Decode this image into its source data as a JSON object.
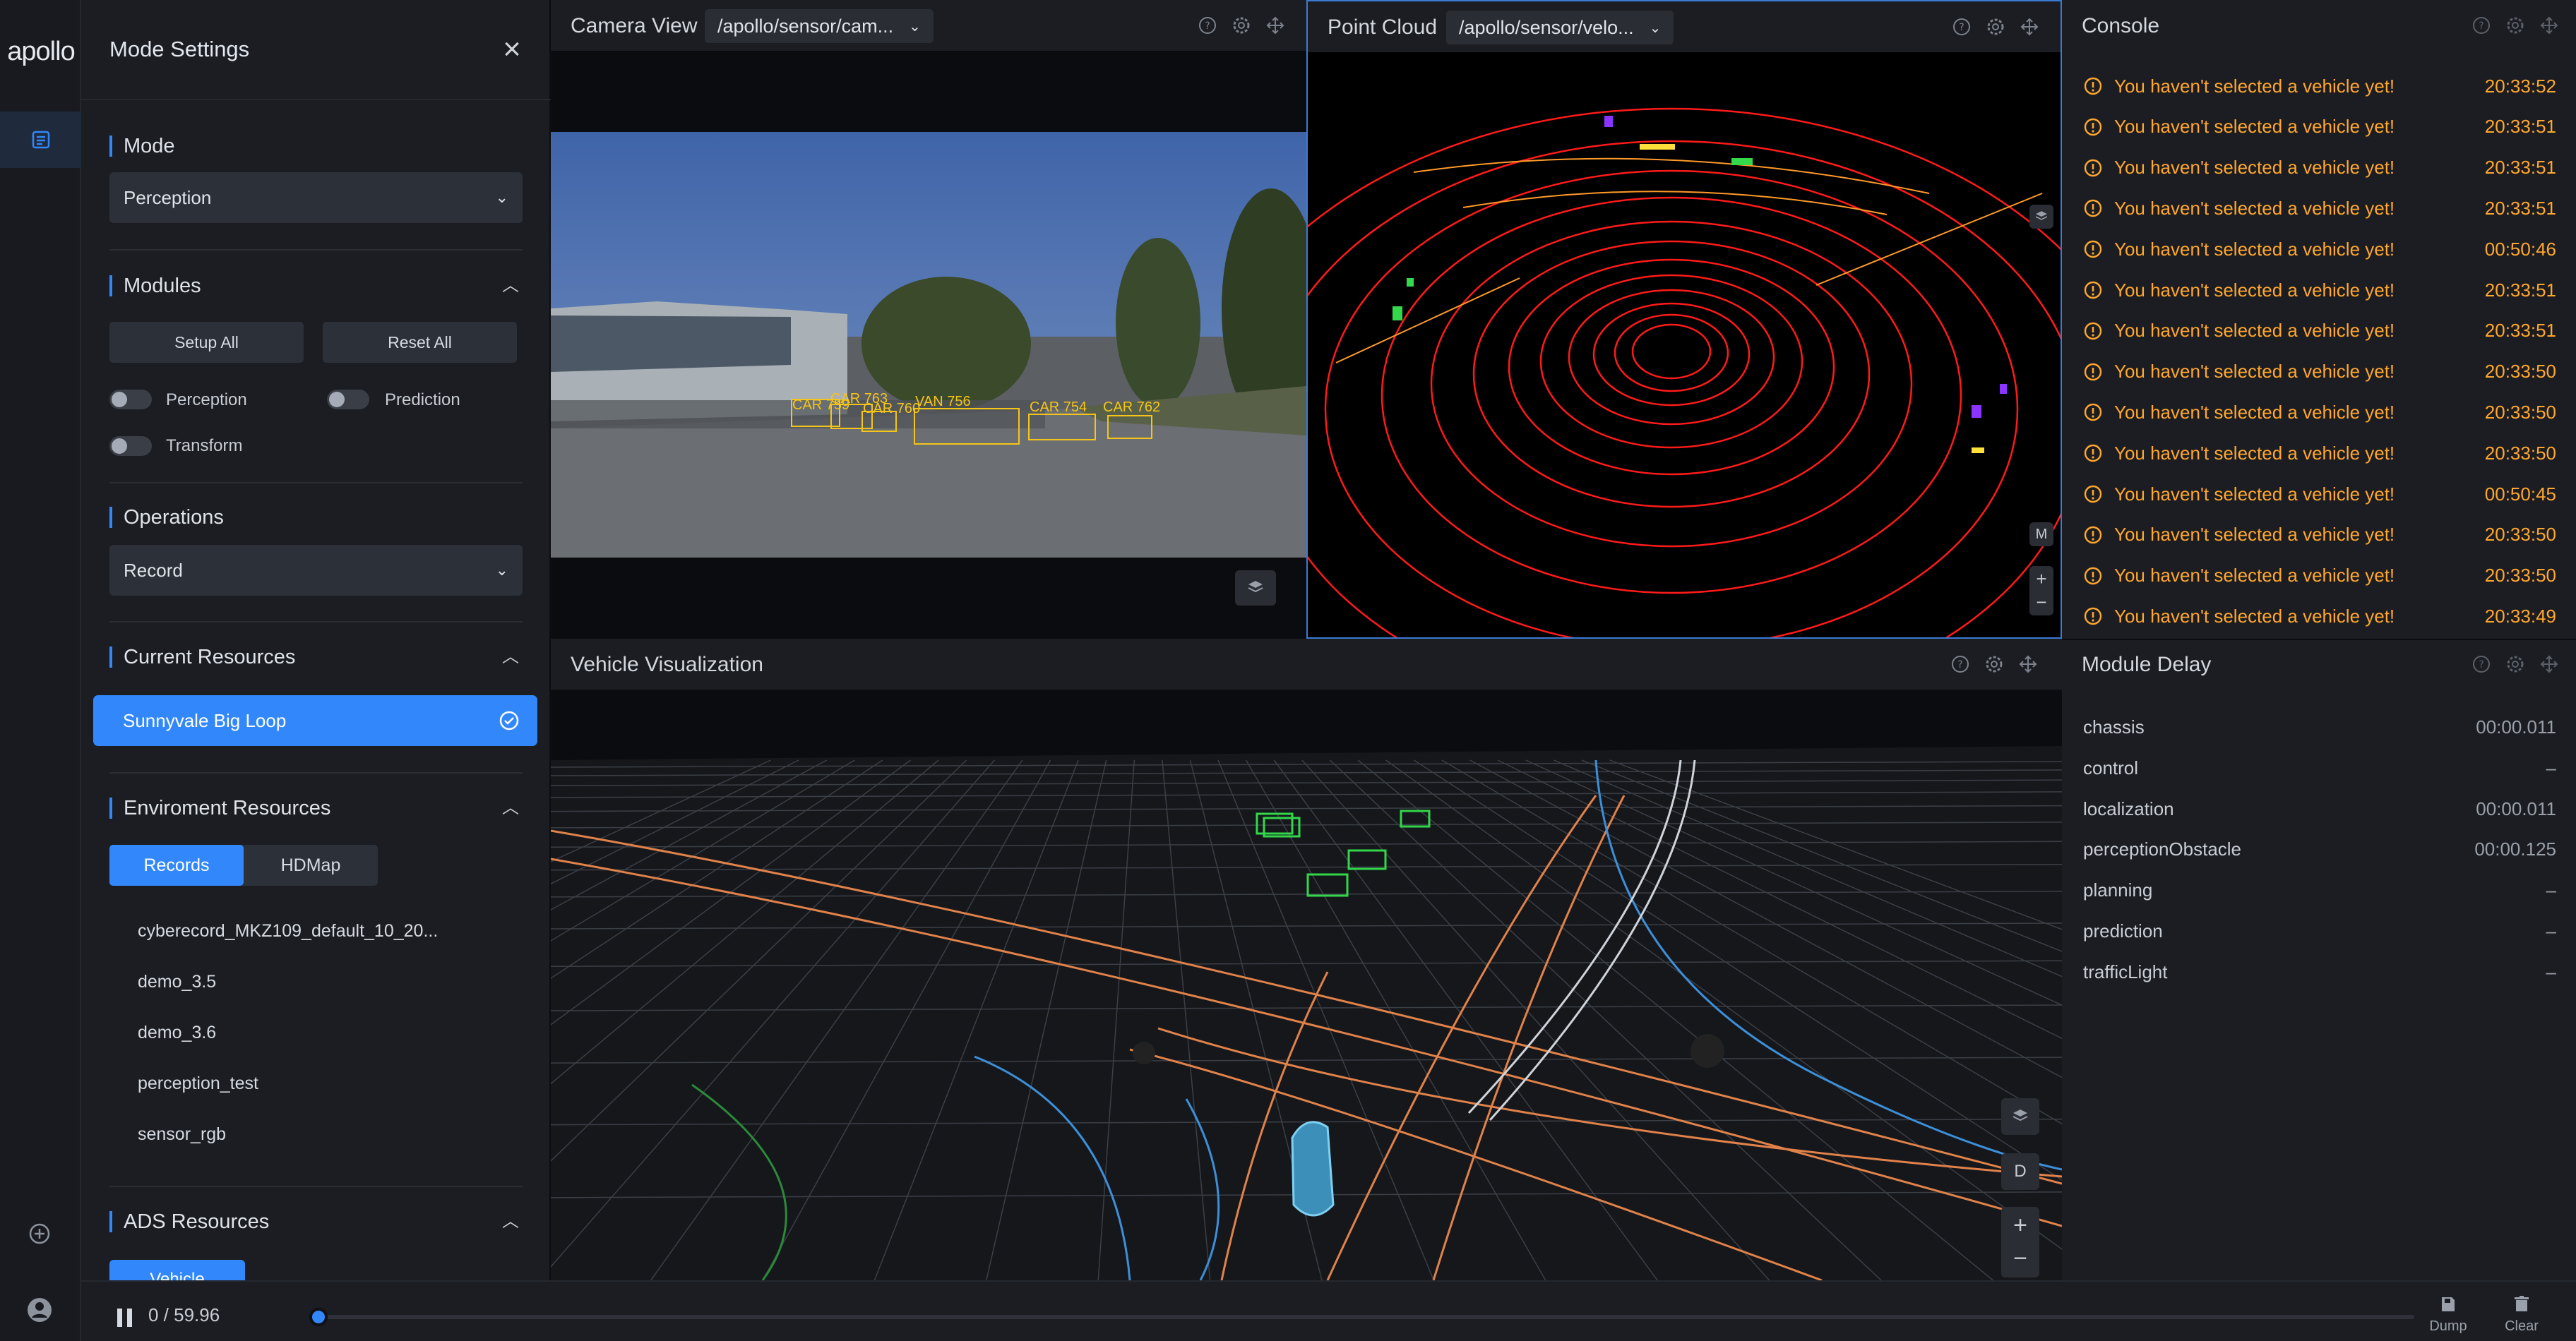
{
  "app": {
    "logo": "apollo"
  },
  "mode_settings": {
    "title": "Mode Settings",
    "mode": {
      "label": "Mode",
      "value": "Perception"
    },
    "modules": {
      "label": "Modules",
      "setup_all": "Setup All",
      "reset_all": "Reset All",
      "items": [
        "Perception",
        "Prediction",
        "Transform"
      ]
    },
    "operations": {
      "label": "Operations",
      "value": "Record"
    },
    "current_resources": {
      "label": "Current Resources",
      "selected": "Sunnyvale Big Loop"
    },
    "environment_resources": {
      "label": "Enviroment Resources",
      "tabs": [
        "Records",
        "HDMap"
      ],
      "active_tab": "Records",
      "records": [
        "cyberecord_MKZ109_default_10_20...",
        "demo_3.5",
        "demo_3.6",
        "perception_test",
        "sensor_rgb"
      ]
    },
    "ads_resources": {
      "label": "ADS Resources",
      "tab": "Vehicle"
    }
  },
  "camera_view": {
    "title": "Camera View",
    "topic": "/apollo/sensor/cam...",
    "detections": [
      "CAR 759",
      "CAR 763",
      "CAR 760",
      "VAN 756",
      "CAR 754",
      "CAR 762"
    ]
  },
  "point_cloud": {
    "title": "Point Cloud",
    "topic": "/apollo/sensor/velo...",
    "controls": [
      "M",
      "+",
      "−"
    ]
  },
  "vehicle_viz": {
    "title": "Vehicle Visualization",
    "controls": [
      "D",
      "+",
      "−"
    ]
  },
  "console": {
    "title": "Console",
    "logs": [
      {
        "text": "You haven't selected a vehicle yet!",
        "time": "20:33:52"
      },
      {
        "text": "You haven't selected a vehicle yet!",
        "time": "20:33:51"
      },
      {
        "text": "You haven't selected a vehicle yet!",
        "time": "20:33:51"
      },
      {
        "text": "You haven't selected a vehicle yet!",
        "time": "20:33:51"
      },
      {
        "text": "You haven't selected a vehicle yet!",
        "time": "00:50:46"
      },
      {
        "text": "You haven't selected a vehicle yet!",
        "time": "20:33:51"
      },
      {
        "text": "You haven't selected a vehicle yet!",
        "time": "20:33:51"
      },
      {
        "text": "You haven't selected a vehicle yet!",
        "time": "20:33:50"
      },
      {
        "text": "You haven't selected a vehicle yet!",
        "time": "20:33:50"
      },
      {
        "text": "You haven't selected a vehicle yet!",
        "time": "20:33:50"
      },
      {
        "text": "You haven't selected a vehicle yet!",
        "time": "00:50:45"
      },
      {
        "text": "You haven't selected a vehicle yet!",
        "time": "20:33:50"
      },
      {
        "text": "You haven't selected a vehicle yet!",
        "time": "20:33:50"
      },
      {
        "text": "You haven't selected a vehicle yet!",
        "time": "20:33:49"
      }
    ]
  },
  "module_delay": {
    "title": "Module Delay",
    "rows": [
      {
        "name": "chassis",
        "value": "00:00.011"
      },
      {
        "name": "control",
        "value": "–"
      },
      {
        "name": "localization",
        "value": "00:00.011"
      },
      {
        "name": "perceptionObstacle",
        "value": "00:00.125"
      },
      {
        "name": "planning",
        "value": "–"
      },
      {
        "name": "prediction",
        "value": "–"
      },
      {
        "name": "trafficLight",
        "value": "–"
      }
    ]
  },
  "playback": {
    "time": "0 / 59.96",
    "progress": 0,
    "dump": "Dump",
    "clear": "Clear"
  },
  "colors": {
    "accent": "#3288fa",
    "warning": "#ffa72e",
    "pointcloud": "#ff1a1a"
  }
}
